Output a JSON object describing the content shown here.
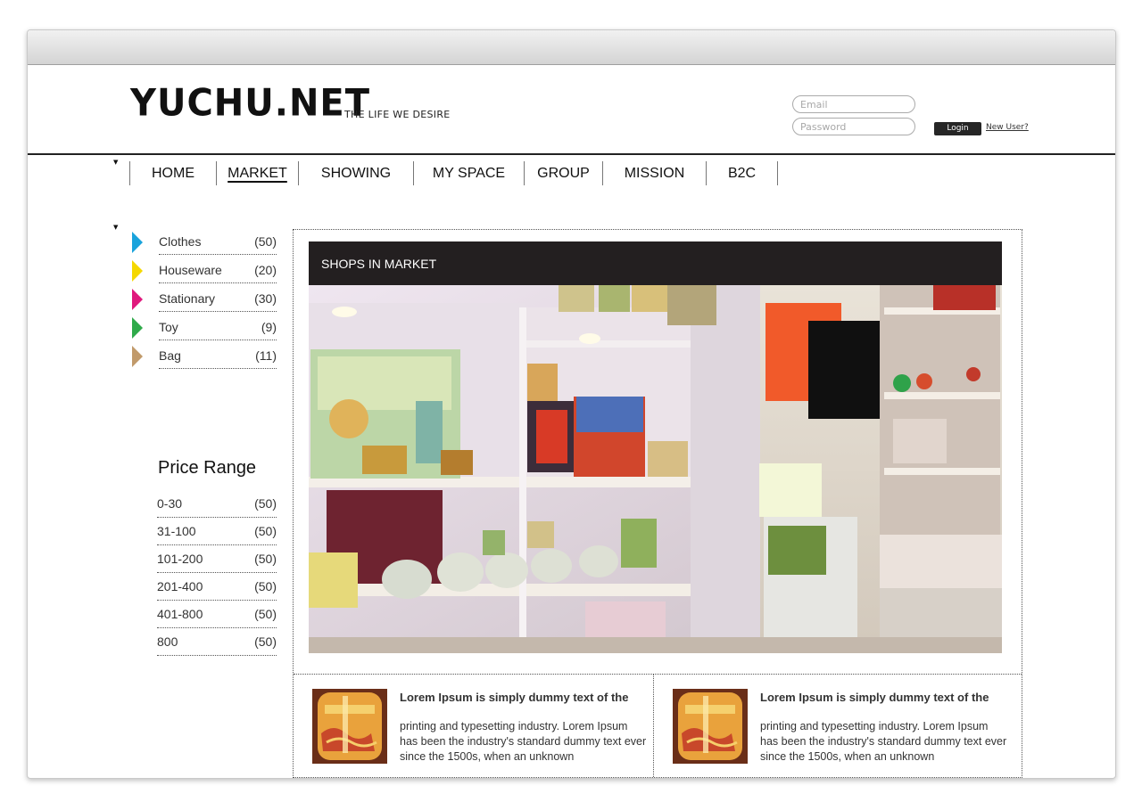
{
  "header": {
    "logo": "YUCHU.NET",
    "tagline": "THE LIFE WE DESIRE",
    "email_placeholder": "Email",
    "password_placeholder": "Password",
    "login_label": "Login",
    "new_user_label": "New User?"
  },
  "nav": {
    "items": [
      {
        "label": "HOME"
      },
      {
        "label": "MARKET",
        "active": true
      },
      {
        "label": "SHOWING"
      },
      {
        "label": "MY SPACE"
      },
      {
        "label": "GROUP"
      },
      {
        "label": "MISSION"
      },
      {
        "label": "B2C"
      }
    ]
  },
  "sidebar": {
    "categories": [
      {
        "label": "Clothes",
        "count": "(50)",
        "color": "#1aa3dc"
      },
      {
        "label": "Houseware",
        "count": "(20)",
        "color": "#f5d800"
      },
      {
        "label": "Stationary",
        "count": "(30)",
        "color": "#e0197d"
      },
      {
        "label": "Toy",
        "count": "(9)",
        "color": "#2faa4a"
      },
      {
        "label": "Bag",
        "count": "(11)",
        "color": "#c19a6b"
      }
    ],
    "price_title": "Price Range",
    "prices": [
      {
        "label": "0-30",
        "count": "(50)"
      },
      {
        "label": "31-100",
        "count": "(50)"
      },
      {
        "label": "101-200",
        "count": "(50)"
      },
      {
        "label": "201-400",
        "count": "(50)"
      },
      {
        "label": "401-800",
        "count": "(50)"
      },
      {
        "label": "800",
        "count": "(50)"
      }
    ]
  },
  "main": {
    "shops_title": "SHOPS IN MARKET",
    "articles": [
      {
        "title": "Lorem Ipsum is simply dummy text of the",
        "body": "printing and typesetting industry. Lorem Ipsum has been the industry's standard dummy text ever since the 1500s, when an unknown"
      },
      {
        "title": "Lorem Ipsum is simply dummy text of the",
        "body": "printing and typesetting industry. Lorem Ipsum has been the industry's standard dummy text ever since the 1500s, when an unknown"
      }
    ]
  },
  "colors": {
    "header_bar": "#231f20",
    "text": "#333333"
  }
}
